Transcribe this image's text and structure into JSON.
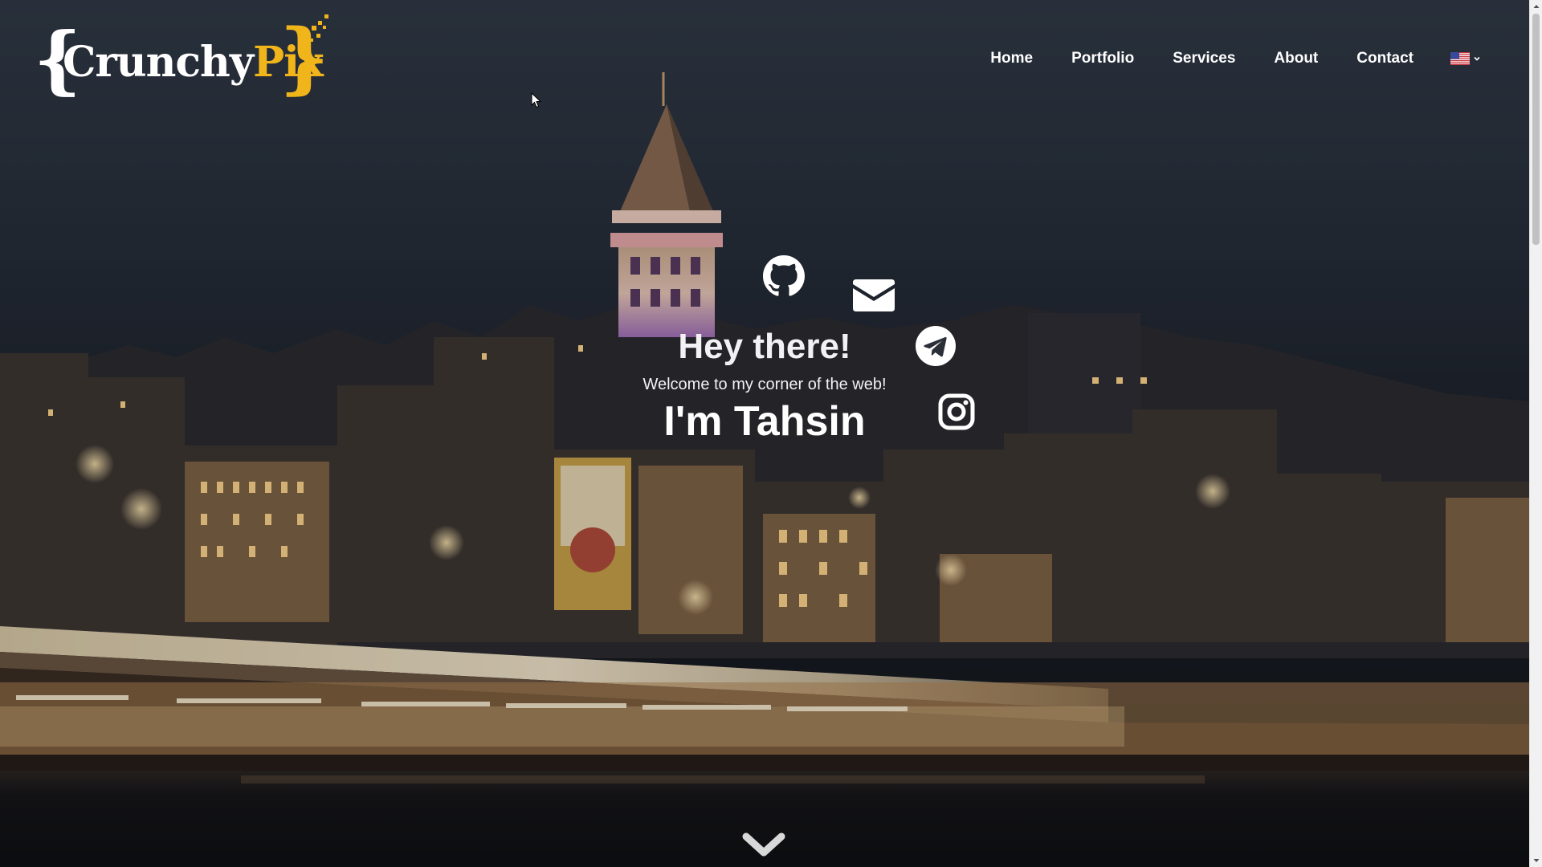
{
  "page": {
    "background_theme": "night city waterfront"
  },
  "header": {
    "logo": {
      "brace_left": "{",
      "word_part1": "Crunchy",
      "word_part2": "Pix",
      "brace_right": "}",
      "accent_color": "#f1b51c"
    },
    "nav": {
      "items": [
        {
          "label": "Home"
        },
        {
          "label": "Portfolio"
        },
        {
          "label": "Services"
        },
        {
          "label": "About"
        },
        {
          "label": "Contact"
        }
      ],
      "language_icon": "us-flag-icon"
    }
  },
  "hero": {
    "greeting": "Hey there!",
    "welcome": "Welcome to my corner of the web!",
    "name": "I'm Tahsin",
    "social_icons": [
      "github-icon",
      "mail-icon",
      "telegram-icon",
      "instagram-icon"
    ],
    "scroll_icon": "chevron-down-icon"
  }
}
